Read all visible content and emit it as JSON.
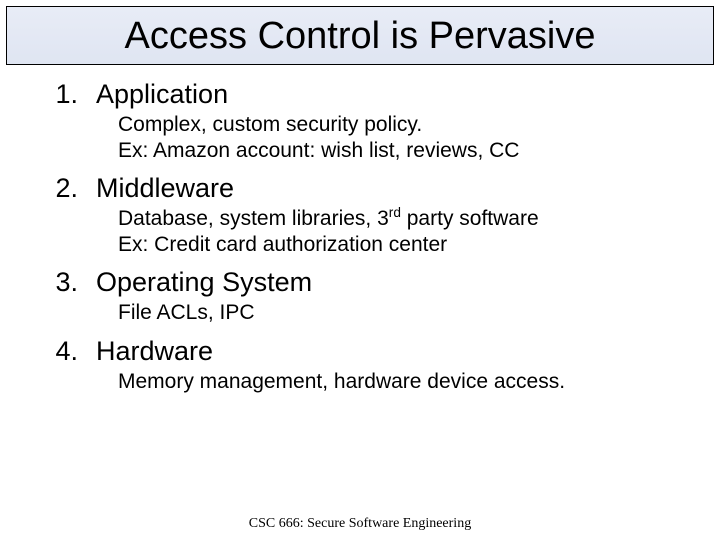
{
  "title": "Access Control is Pervasive",
  "items": [
    {
      "num": "1.",
      "heading": "Application",
      "sub1": "Complex, custom security policy.",
      "sub2": "Ex: Amazon account: wish list, reviews, CC"
    },
    {
      "num": "2.",
      "heading": "Middleware",
      "sub1_pre": "Database, system libraries, 3",
      "sub1_sup": "rd",
      "sub1_post": " party software",
      "sub2": "Ex: Credit card authorization center"
    },
    {
      "num": "3.",
      "heading": "Operating System",
      "sub1": "File ACLs, IPC"
    },
    {
      "num": "4.",
      "heading": "Hardware",
      "sub1": "Memory management, hardware device access."
    }
  ],
  "footer": "CSC 666: Secure Software Engineering"
}
